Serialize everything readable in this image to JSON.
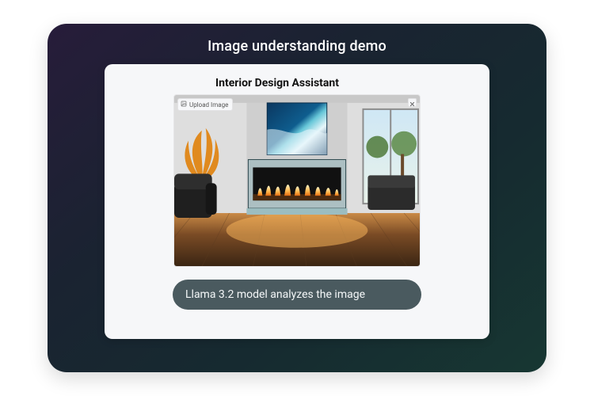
{
  "header": {
    "title": "Image understanding demo"
  },
  "demo": {
    "app_title": "Interior Design Assistant",
    "upload_label": "Upload Image",
    "caption": "Llama 3.2 model analyzes the image"
  },
  "icons": {
    "upload": "upload-icon",
    "close": "close-icon"
  }
}
